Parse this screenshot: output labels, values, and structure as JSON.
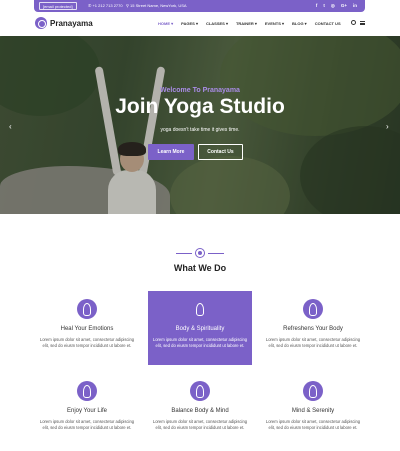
{
  "topbar": {
    "email": "[email protected]",
    "phone": "+1 212 713 2770",
    "address": "15 Street Name, NewYork, USA",
    "socials": [
      "f",
      "t",
      "◎",
      "G+",
      "in"
    ]
  },
  "header": {
    "logo": "Pranayama",
    "nav": [
      {
        "label": "HOME ▾",
        "active": true
      },
      {
        "label": "PAGES ▾"
      },
      {
        "label": "CLASSES ▾"
      },
      {
        "label": "TRAINER ▾"
      },
      {
        "label": "EVENTS ▾"
      },
      {
        "label": "BLOG ▾"
      },
      {
        "label": "CONTACT US"
      }
    ]
  },
  "hero": {
    "welcome": "Welcome To Pranayama",
    "title": "Join Yoga Studio",
    "subtitle": "yoga doesn't take time it gives time.",
    "learn_more": "Learn More",
    "contact": "Contact Us",
    "prev": "‹",
    "next": "›"
  },
  "section": {
    "title": "What We Do"
  },
  "services": [
    {
      "title": "Heal Your Emotions",
      "text": "Lorem ipsum dolor sit amet, consectetur adipiscing elit, sed do eiusm tempor incididunt ut labore et.",
      "highlight": false
    },
    {
      "title": "Body & Spirituality",
      "text": "Lorem ipsum dolor sit amet, consectetur adipiscing elit, sed do eiusm tempor incididunt ut labore et.",
      "highlight": true
    },
    {
      "title": "Refreshens Your Body",
      "text": "Lorem ipsum dolor sit amet, consectetur adipiscing elit, sed do eiusm tempor incididunt ut labore et.",
      "highlight": false
    },
    {
      "title": "Enjoy Your Life",
      "text": "Lorem ipsum dolor sit amet, consectetur adipiscing elit, sed do eiusm tempor incididunt ut labore et.",
      "highlight": false
    },
    {
      "title": "Balance Body & Mind",
      "text": "Lorem ipsum dolor sit amet, consectetur adipiscing elit, sed do eiusm tempor incididunt ut labore et.",
      "highlight": false
    },
    {
      "title": "Mind & Serenity",
      "text": "Lorem ipsum dolor sit amet, consectetur adipiscing elit, sed do eiusm tempor incididunt ut labore et.",
      "highlight": false
    }
  ],
  "colors": {
    "accent": "#7b61c8",
    "text": "#333333"
  }
}
